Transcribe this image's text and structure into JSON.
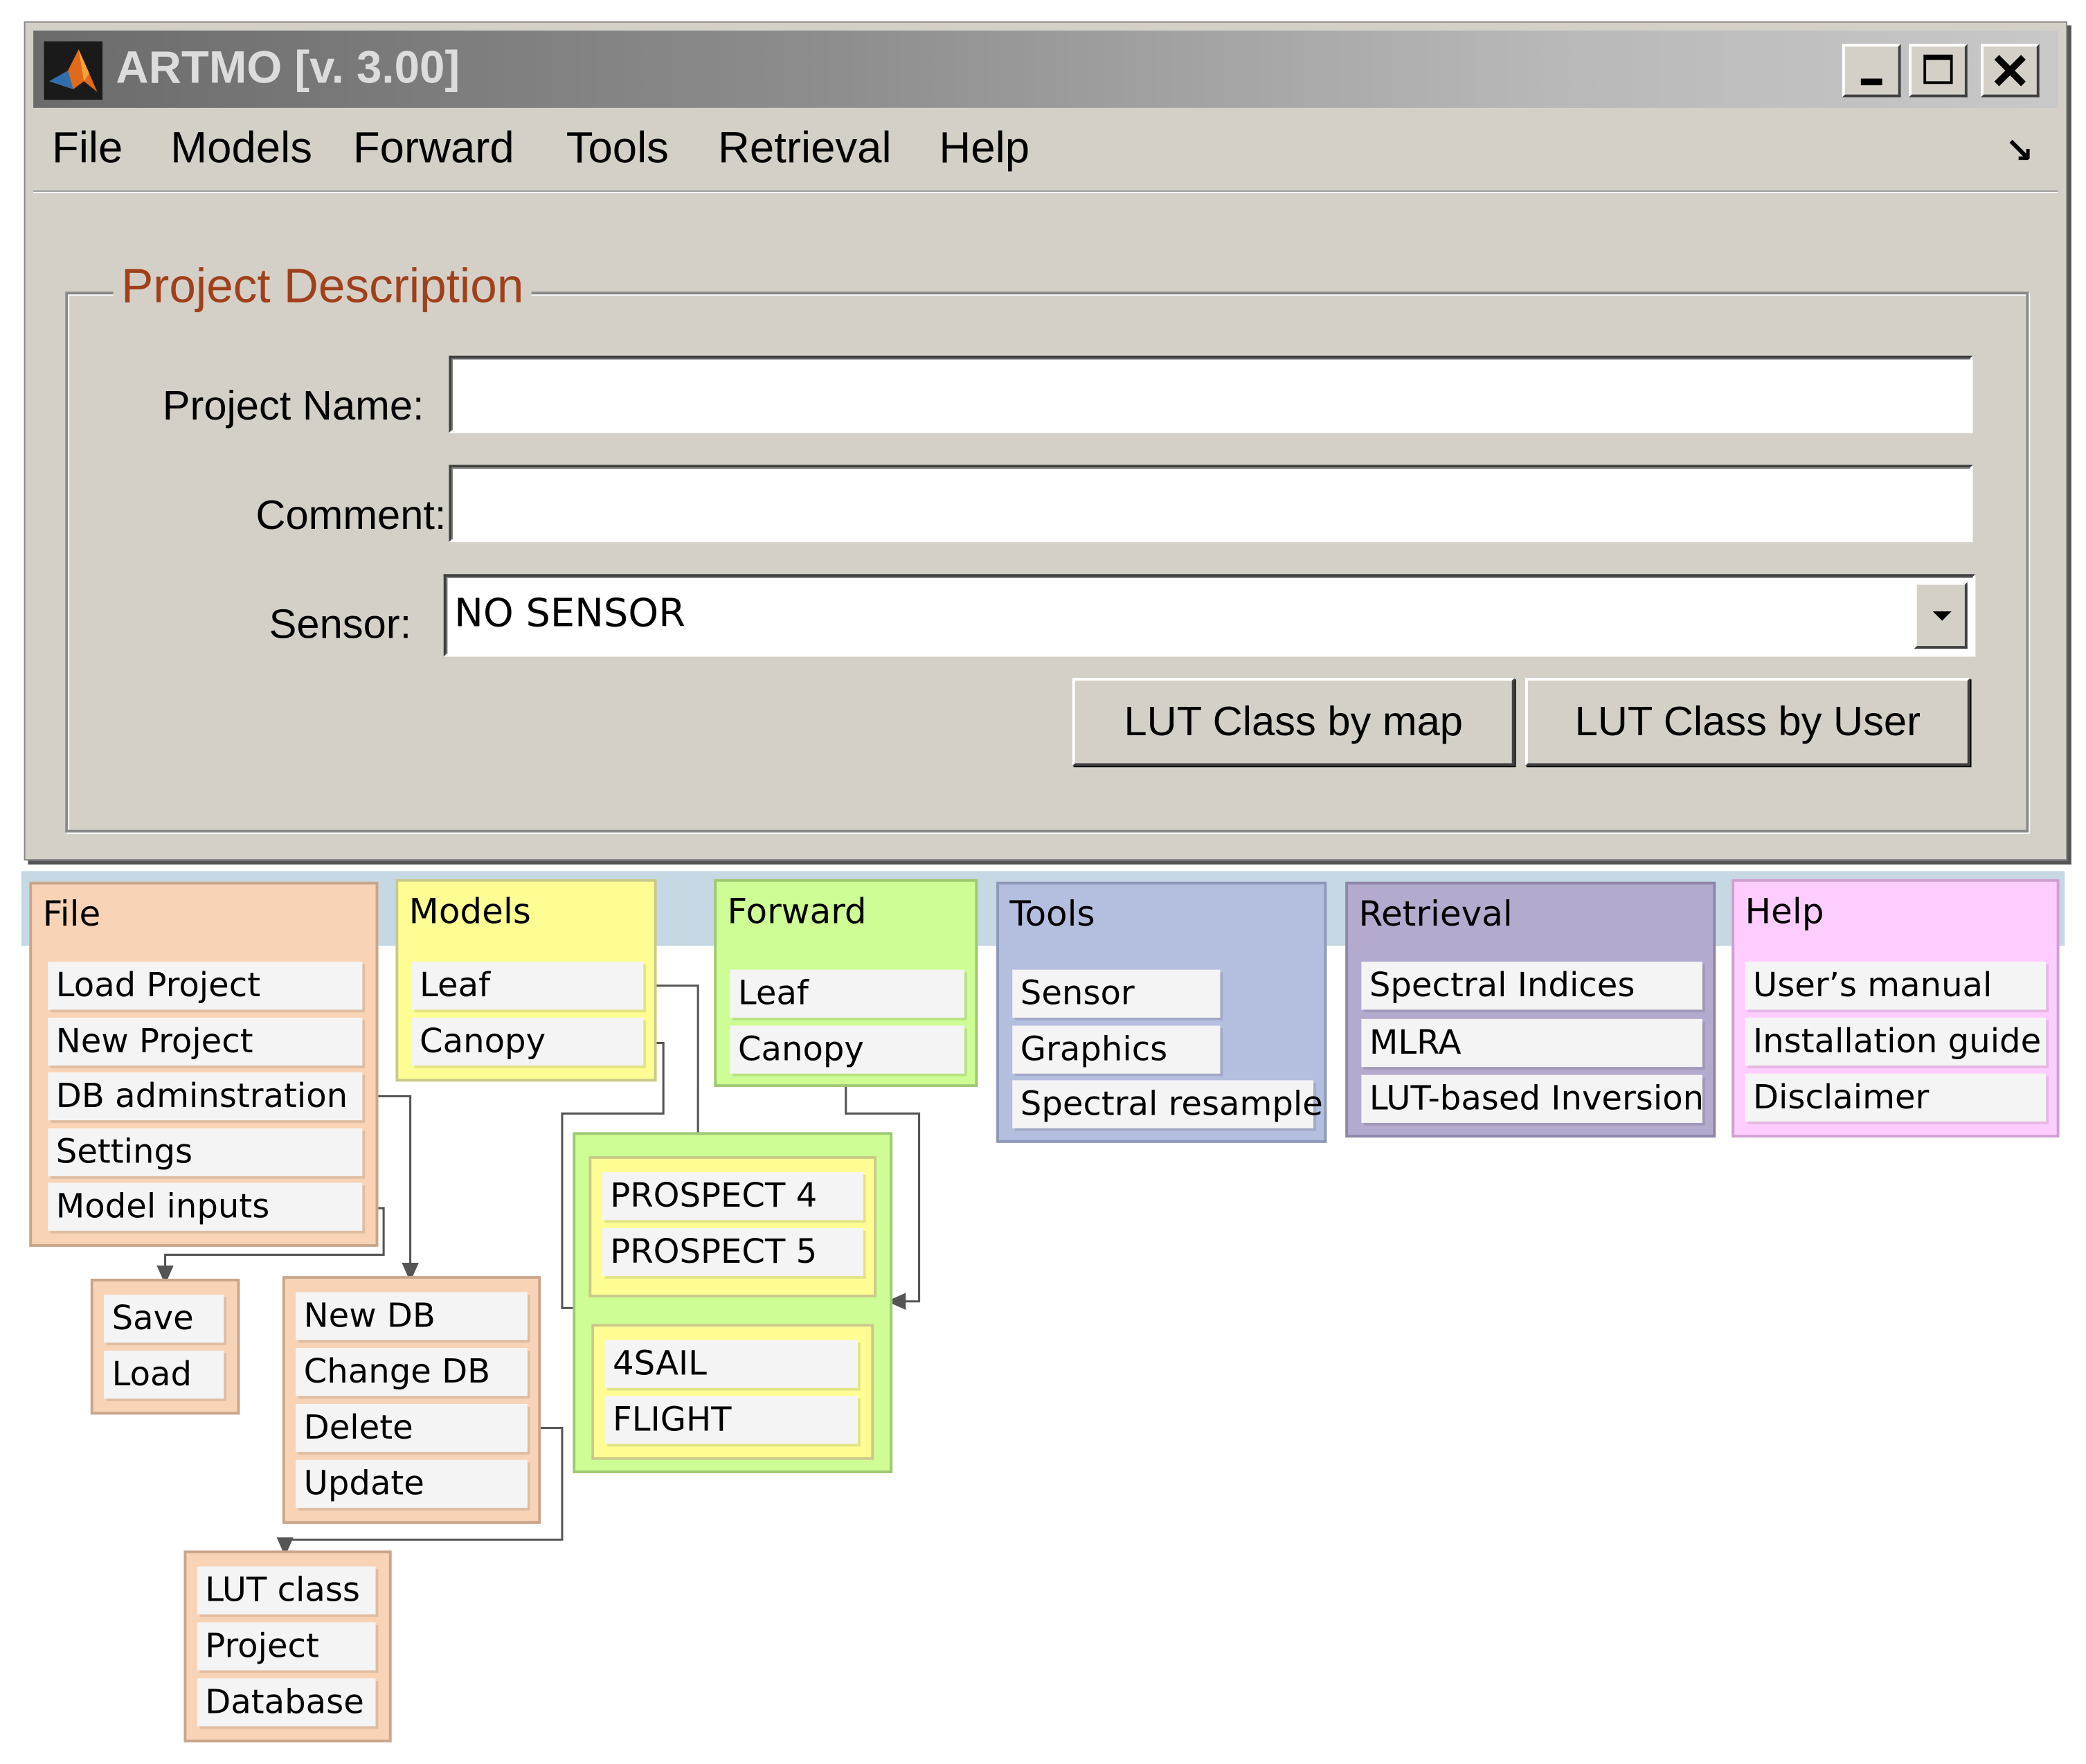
{
  "window": {
    "title": "ARTMO [v. 3.00]",
    "menu": [
      "File",
      "Models",
      "Forward",
      "Tools",
      "Retrieval",
      "Help"
    ],
    "form": {
      "group_title": "Project Description",
      "project_name_label": "Project Name:",
      "project_name_value": "",
      "comment_label": "Comment:",
      "comment_value": "",
      "sensor_label": "Sensor:",
      "sensor_value": "NO SENSOR",
      "btn_lut_by_map": "LUT Class by map",
      "btn_lut_by_user": "LUT Class by User"
    }
  },
  "menu_map": {
    "file": {
      "title": "File",
      "items": [
        "Load Project",
        "New Project",
        "DB adminstration",
        "Settings",
        "Model inputs"
      ]
    },
    "models": {
      "title": "Models",
      "items": [
        "Leaf",
        "Canopy"
      ]
    },
    "forward": {
      "title": "Forward",
      "items": [
        "Leaf",
        "Canopy"
      ]
    },
    "tools": {
      "title": "Tools",
      "items": [
        "Sensor",
        "Graphics",
        "Spectral resample"
      ]
    },
    "retrieval": {
      "title": "Retrieval",
      "items": [
        "Spectral Indices",
        "MLRA",
        "LUT-based Inversion"
      ]
    },
    "help": {
      "title": "Help",
      "items": [
        "User’s manual",
        "Installation guide",
        "Disclaimer"
      ]
    },
    "model_inputs_sub": [
      "Save",
      "Load"
    ],
    "db_admin_sub": [
      "New DB",
      "Change DB",
      "Delete",
      "Update"
    ],
    "delete_sub": [
      "LUT class",
      "Project",
      "Database"
    ],
    "leaf_models": [
      "PROSPECT 4",
      "PROSPECT 5"
    ],
    "canopy_models": [
      "4SAIL",
      "FLIGHT"
    ]
  },
  "colors": {
    "file": "#f8d3b5",
    "models": "#fdfd94",
    "forward": "#cefc95",
    "tools": "#b4bede",
    "retrieval": "#b4aace",
    "help": "#fdcdfd",
    "group_title": "#a0401a"
  }
}
